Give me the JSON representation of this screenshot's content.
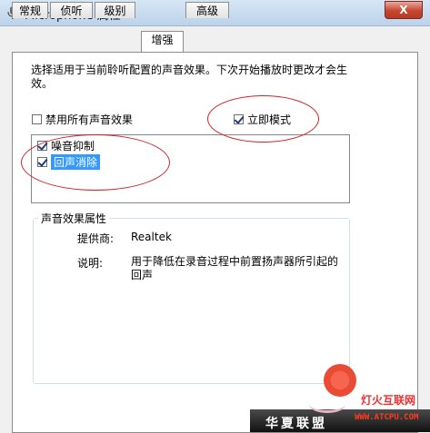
{
  "window": {
    "title": "Microphone 属性",
    "close_glyph": "X",
    "icon": "microphone-icon"
  },
  "tabs": [
    {
      "label": "常规",
      "active": false
    },
    {
      "label": "侦听",
      "active": false
    },
    {
      "label": "级别",
      "active": false
    },
    {
      "label": "增强",
      "active": true
    },
    {
      "label": "高级",
      "active": false
    }
  ],
  "enhancements": {
    "description": "选择适用于当前聆听配置的声音效果。下次开始播放时更改才会生效。",
    "disable_all": {
      "label": "禁用所有声音效果",
      "checked": false
    },
    "immediate_mode": {
      "label": "立即模式",
      "checked": true
    },
    "effects": [
      {
        "label": "噪音抑制",
        "checked": true,
        "selected": false
      },
      {
        "label": "回声消除",
        "checked": true,
        "selected": true
      }
    ]
  },
  "properties": {
    "group_title": "声音效果属性",
    "provider_label": "提供商:",
    "provider_value": "Realtek",
    "description_label": "说明:",
    "description_value": "用于降低在录音过程中前置扬声器所引起的回声"
  },
  "watermark": {
    "left_text": "华夏联盟",
    "site_name": "灯火互联网",
    "site_url": "WWW.ATCPU.COM"
  },
  "colors": {
    "annotation": "#d62020",
    "selection": "#3399ff",
    "titlebar": "#c8dcf0"
  }
}
